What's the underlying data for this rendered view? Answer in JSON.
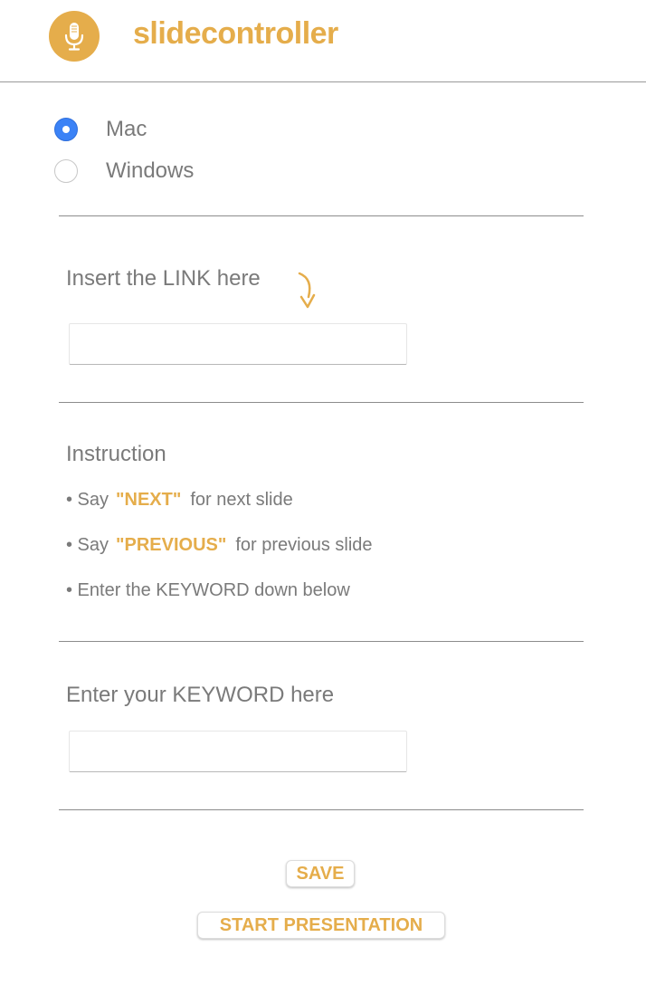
{
  "header": {
    "logo_icon": "microphone-icon",
    "brand": "slidecontroller"
  },
  "os_options": {
    "items": [
      {
        "label": "Mac",
        "checked": true
      },
      {
        "label": "Windows",
        "checked": false
      }
    ]
  },
  "link_section": {
    "title": "Insert the LINK here",
    "arrow_icon": "curved-arrow-down-icon",
    "input_value": "",
    "input_placeholder": ""
  },
  "instruction_section": {
    "title": "Instruction",
    "items": [
      {
        "prefix": "• Say",
        "keyword": "\"NEXT\"",
        "suffix": "for next slide"
      },
      {
        "prefix": "• Say",
        "keyword": "\"PREVIOUS\"",
        "suffix": "for previous slide"
      },
      {
        "text": "• Enter the KEYWORD down below"
      }
    ]
  },
  "keyword_section": {
    "title": "Enter your KEYWORD here",
    "input_value": "",
    "input_placeholder": ""
  },
  "buttons": {
    "save": "SAVE",
    "start": "START PRESENTATION"
  },
  "colors": {
    "accent": "#e5ad4b",
    "radio_selected": "#3b82f6",
    "text": "#7a7a7a"
  }
}
